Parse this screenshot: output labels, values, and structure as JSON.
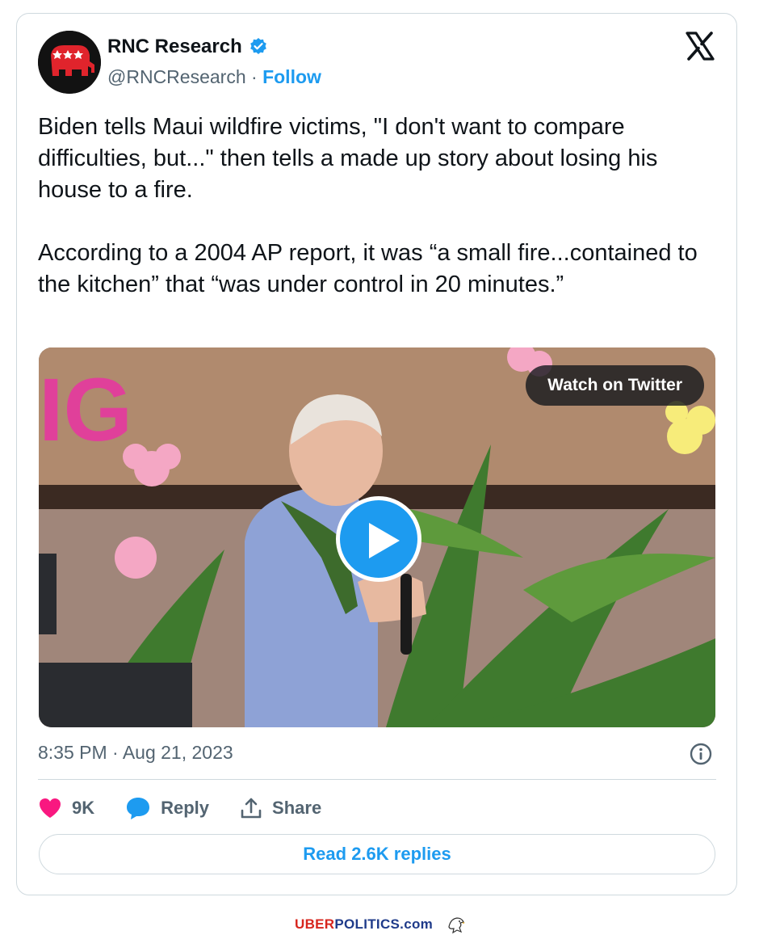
{
  "author": {
    "name": "RNC Research",
    "handle": "@RNCResearch",
    "separator": " · ",
    "follow_label": "Follow",
    "verified_color": "#1d9bf0"
  },
  "platform_icon": "x-logo-icon",
  "tweet": {
    "text": "Biden tells Maui wildfire victims, \"I don't want to compare difficulties, but...\" then tells a made up story about losing his house to a fire.\n\nAccording to a 2004 AP report, it was “a small fire...contained to the kitchen” that “was under control in 20 minutes.”"
  },
  "media": {
    "watch_label": "Watch on Twitter",
    "play_icon": "play-icon",
    "backdrop_letters": "IG"
  },
  "meta": {
    "timestamp": "8:35 PM · Aug 21, 2023"
  },
  "actions": {
    "like_count": "9K",
    "reply_label": "Reply",
    "share_label": "Share"
  },
  "read_replies_label": "Read 2.6K replies",
  "footer": {
    "brand_uber": "UBER",
    "brand_rest": "POLITICS.com"
  },
  "colors": {
    "accent": "#1d9bf0",
    "like": "#f91880",
    "text_primary": "#0f1419",
    "text_secondary": "#536471",
    "border": "#cfd9de"
  }
}
